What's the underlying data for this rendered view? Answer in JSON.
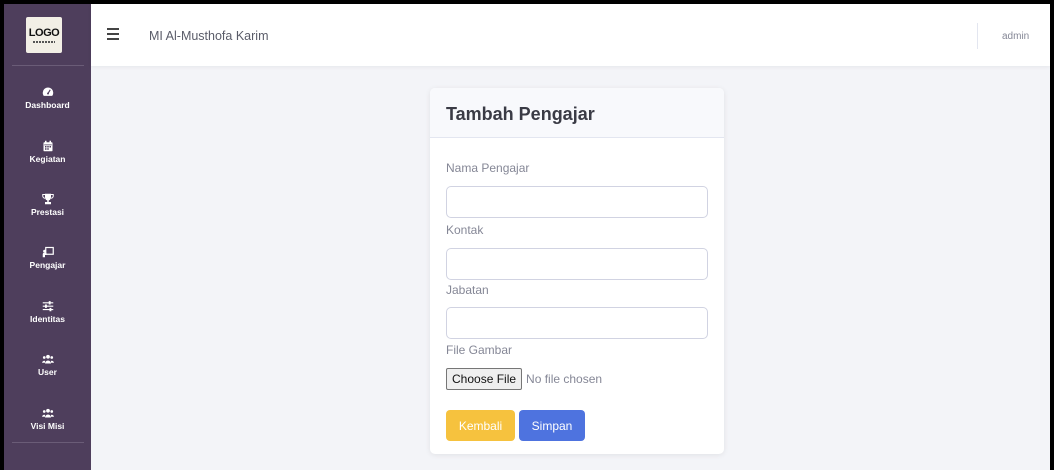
{
  "sidebar": {
    "logo": {
      "text": "LOGO"
    },
    "items": [
      {
        "label": "Dashboard",
        "icon": "tachometer-icon"
      },
      {
        "label": "Kegiatan",
        "icon": "calendar-icon"
      },
      {
        "label": "Prestasi",
        "icon": "trophy-icon"
      },
      {
        "label": "Pengajar",
        "icon": "chalkboard-teacher-icon"
      },
      {
        "label": "Identitas",
        "icon": "sliders-icon"
      },
      {
        "label": "User",
        "icon": "users-icon"
      },
      {
        "label": "Visi Misi",
        "icon": "users-icon"
      }
    ]
  },
  "topbar": {
    "site_title": "MI Al-Musthofa Karim",
    "user_name": "admin"
  },
  "form": {
    "title": "Tambah Pengajar",
    "fields": [
      {
        "label": "Nama Pengajar",
        "value": ""
      },
      {
        "label": "Kontak",
        "value": ""
      },
      {
        "label": "Jabatan",
        "value": ""
      }
    ],
    "file": {
      "label": "File Gambar",
      "button": "Choose File",
      "status": "No file chosen"
    },
    "back_label": "Kembali",
    "save_label": "Simpan"
  },
  "colors": {
    "sidebar_bg": "#4e3e5c",
    "warning": "#f6c23e",
    "primary": "#4e73df",
    "page_bg": "#f3f4f8"
  }
}
